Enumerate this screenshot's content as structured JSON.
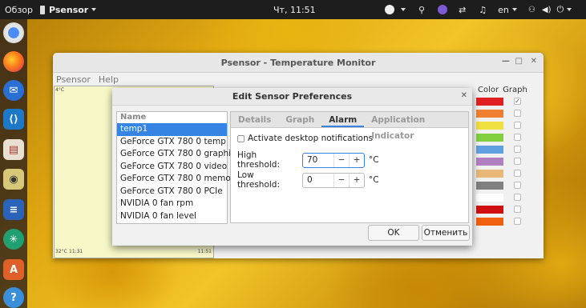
{
  "topbar": {
    "activities": "Обзор",
    "app_menu": "Psensor",
    "clock": "Чт, 11:51",
    "language": "en"
  },
  "main_window": {
    "title": "Psensor - Temperature Monitor",
    "menu": [
      "Psensor",
      "Help"
    ],
    "graph": {
      "y_top": "4°C",
      "y_bottom": "32°C",
      "x_left": "11:31",
      "x_right": "11:51"
    },
    "columns": {
      "color": "Color",
      "graph": "Graph"
    },
    "sensor_colors": [
      "#e02020",
      "#f08030",
      "#f0e040",
      "#80d040",
      "#60a0e0",
      "#b080c0",
      "#e8b878",
      "#808080",
      "#ffffff",
      "#d01010",
      "#f06010"
    ]
  },
  "dialog": {
    "title": "Edit Sensor Preferences",
    "list_header": "Name",
    "sensors": [
      "temp1",
      "GeForce GTX 780 0 temp",
      "GeForce GTX 780 0 graphics",
      "GeForce GTX 780 0 video",
      "GeForce GTX 780 0 memory",
      "GeForce GTX 780 0 PCIe",
      "NVIDIA 0 fan rpm",
      "NVIDIA 0 fan level"
    ],
    "tabs": [
      "Details",
      "Graph",
      "Alarm",
      "Application Indicator"
    ],
    "active_tab": "Alarm",
    "notification_label": "Activate desktop notifications",
    "high_label": "High threshold:",
    "high_value": "70",
    "low_label": "Low threshold:",
    "low_value": "0",
    "unit": "°C",
    "minus": "−",
    "plus": "+",
    "ok": "OK",
    "cancel": "Отменить"
  }
}
